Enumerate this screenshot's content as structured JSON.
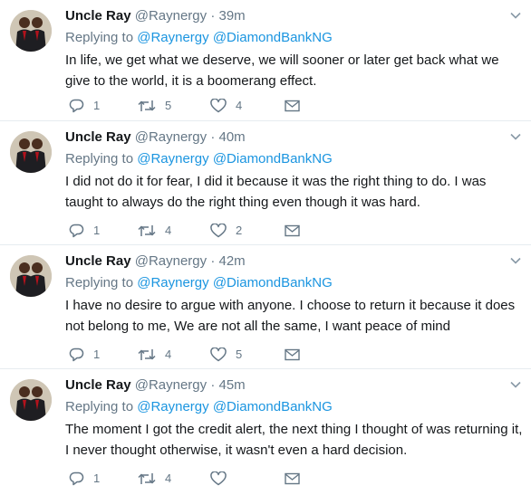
{
  "tweets": [
    {
      "name": "Uncle Ray",
      "handle": "@Raynergy",
      "time": "39m",
      "replying_label": "Replying to",
      "mentions": [
        "@Raynergy",
        "@DiamondBankNG"
      ],
      "text": "In life, we get what we deserve, we will sooner or later get back what we give to the world, it is a boomerang effect.",
      "replies": "1",
      "retweets": "5",
      "likes": "4"
    },
    {
      "name": "Uncle Ray",
      "handle": "@Raynergy",
      "time": "40m",
      "replying_label": "Replying to",
      "mentions": [
        "@Raynergy",
        "@DiamondBankNG"
      ],
      "text": "I did not do it for fear, I did it because it was the right thing to do. I was taught to always do the right thing even though it was hard.",
      "replies": "1",
      "retweets": "4",
      "likes": "2"
    },
    {
      "name": "Uncle Ray",
      "handle": "@Raynergy",
      "time": "42m",
      "replying_label": "Replying to",
      "mentions": [
        "@Raynergy",
        "@DiamondBankNG"
      ],
      "text": "I have no desire to argue with anyone. I choose to return it because it does not belong to me, We are not all the same, I want peace of mind",
      "replies": "1",
      "retweets": "4",
      "likes": "5"
    },
    {
      "name": "Uncle Ray",
      "handle": "@Raynergy",
      "time": "45m",
      "replying_label": "Replying to",
      "mentions": [
        "@Raynergy",
        "@DiamondBankNG"
      ],
      "text": "The moment I got the credit alert, the next thing I thought of was returning it,  I never thought otherwise, it wasn't even a hard decision.",
      "replies": "1",
      "retweets": "4",
      "likes": ""
    }
  ],
  "icons": {
    "reply": "reply-icon",
    "retweet": "retweet-icon",
    "like": "heart-icon",
    "message": "envelope-icon",
    "more": "chevron-down-icon"
  },
  "colors": {
    "link": "#1b95e0",
    "secondary_text": "#657786",
    "divider": "#e6ecf0"
  }
}
